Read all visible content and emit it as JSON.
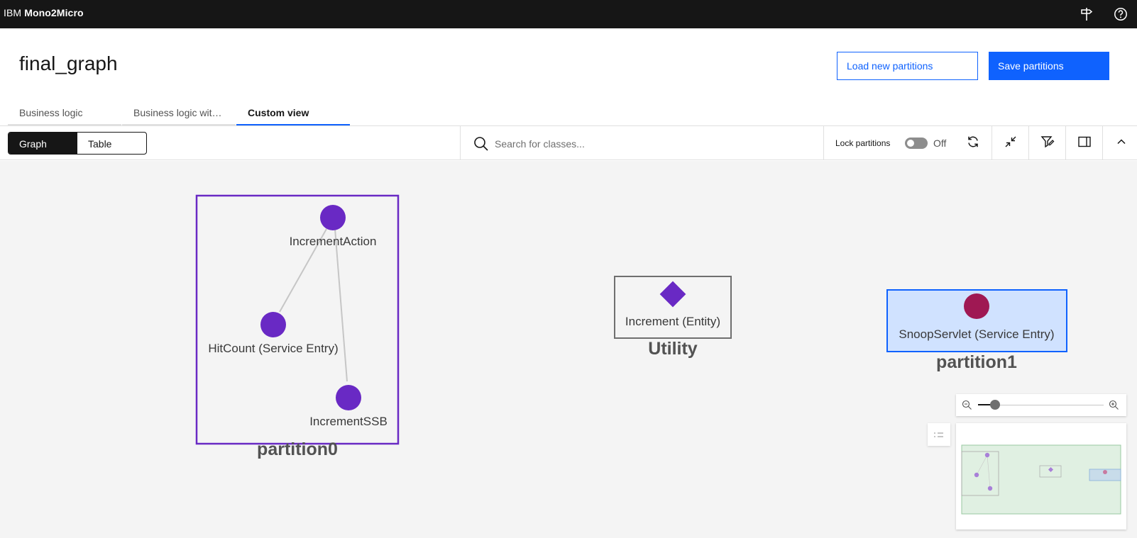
{
  "header": {
    "brand_prefix": "IBM",
    "brand_name": "Mono2Micro",
    "icons": [
      "signpost-icon",
      "help-icon"
    ]
  },
  "page": {
    "title": "final_graph",
    "load_button": "Load new partitions",
    "save_button": "Save partitions"
  },
  "tabs": [
    {
      "label": "Business logic",
      "active": false
    },
    {
      "label": "Business logic wit…",
      "active": false
    },
    {
      "label": "Custom view",
      "active": true
    }
  ],
  "toolbar": {
    "view_switch": [
      "Graph",
      "Table"
    ],
    "selected_view": "Graph",
    "search_placeholder": "Search for classes...",
    "search_value": "",
    "lock_label": "Lock partitions",
    "lock_state": "Off",
    "tool_icons": [
      "refresh-icon",
      "collapse-icon",
      "filter-edit-icon",
      "side-panel-icon",
      "chevron-up-icon"
    ]
  },
  "graph": {
    "partitions": [
      {
        "name": "partition0",
        "color": "#6929c4",
        "nodes": [
          "IncrementAction",
          "HitCount (Service Entry)",
          "IncrementSSB"
        ]
      },
      {
        "name": "Utility",
        "color": "#6f6f6f",
        "nodes": [
          "Increment (Entity)"
        ]
      },
      {
        "name": "partition1",
        "color": "#0f62fe",
        "nodes": [
          "SnoopServlet (Service Entry)"
        ]
      }
    ],
    "edges": [
      [
        "IncrementAction",
        "HitCount (Service Entry)"
      ],
      [
        "IncrementAction",
        "IncrementSSB"
      ]
    ],
    "node_colors": {
      "class": "#6929c4",
      "entity": "#6929c4",
      "servlet": "#9f1853"
    }
  }
}
